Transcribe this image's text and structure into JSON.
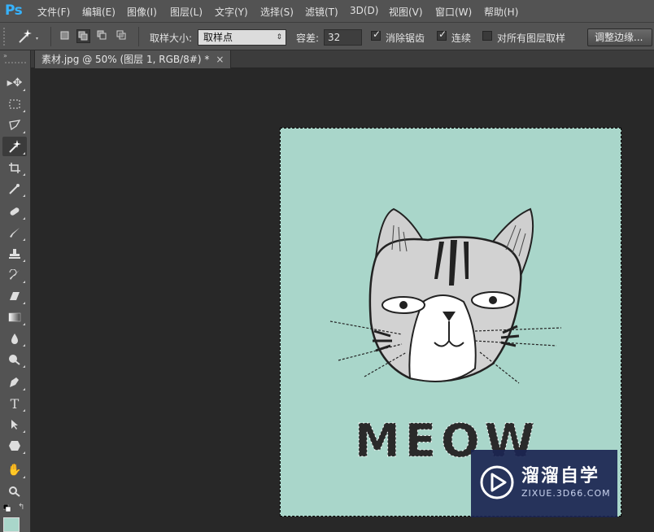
{
  "app": {
    "logo": "Ps"
  },
  "menu": [
    "文件(F)",
    "编辑(E)",
    "图像(I)",
    "图层(L)",
    "文字(Y)",
    "选择(S)",
    "滤镜(T)",
    "3D(D)",
    "视图(V)",
    "窗口(W)",
    "帮助(H)"
  ],
  "options": {
    "tool_icon": "magic-wand-icon",
    "sample_size_label": "取样大小:",
    "sample_size_value": "取样点",
    "tolerance_label": "容差:",
    "tolerance_value": "32",
    "antialias_label": "消除锯齿",
    "antialias_checked": true,
    "contiguous_label": "连续",
    "contiguous_checked": true,
    "sample_all_label": "对所有图层取样",
    "sample_all_checked": false,
    "refine_edge_label": "调整边缘..."
  },
  "document": {
    "tab_title": "素材.jpg @ 50% (图层 1, RGB/8#) *",
    "close_glyph": "×"
  },
  "artwork": {
    "text": "MEOW",
    "background_color": "#a9d6ca"
  },
  "watermark": {
    "brand": "溜溜自学",
    "url": "ZIXUE.3D66.COM"
  },
  "tools": [
    "move-icon",
    "marquee-icon",
    "lasso-icon",
    "magic-wand-icon",
    "crop-icon",
    "eyedropper-icon",
    "healing-brush-icon",
    "brush-icon",
    "clone-stamp-icon",
    "history-brush-icon",
    "eraser-icon",
    "gradient-icon",
    "blur-icon",
    "dodge-icon",
    "pen-icon",
    "type-icon",
    "path-selection-icon",
    "shape-icon",
    "hand-icon",
    "zoom-icon"
  ]
}
